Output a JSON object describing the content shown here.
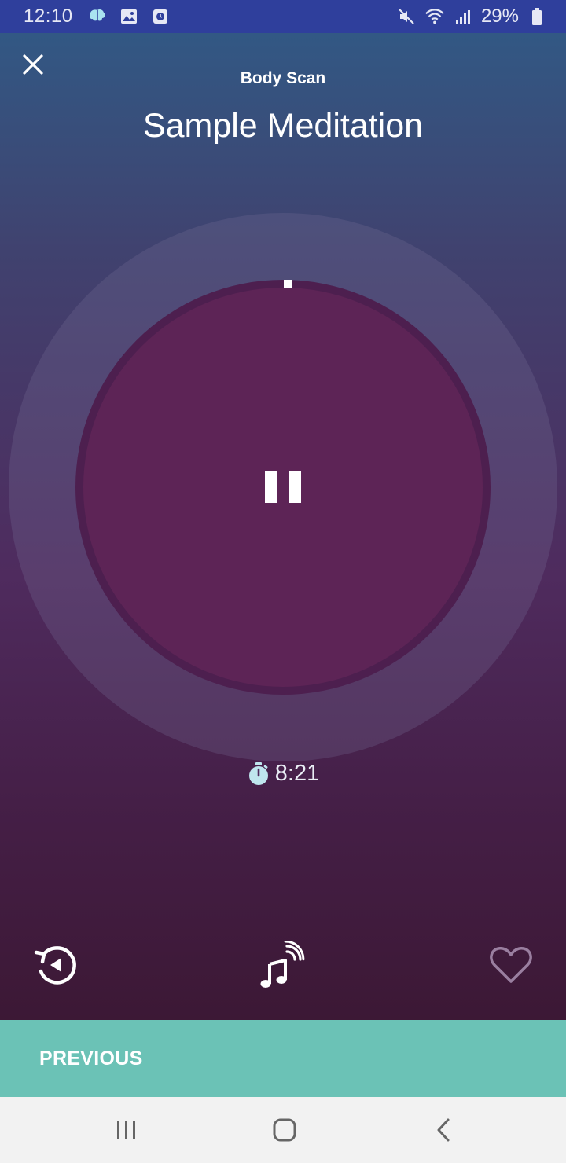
{
  "status_bar": {
    "time": "12:10",
    "battery_percent": "29%",
    "icons": [
      "brain-notification-icon",
      "gallery-notification-icon",
      "clock-notification-icon",
      "mute-icon",
      "wifi-icon",
      "signal-icon",
      "battery-icon"
    ]
  },
  "player": {
    "category": "Body Scan",
    "title": "Sample Meditation",
    "progress": 0.003,
    "state": "playing",
    "timer": "8:21"
  },
  "controls": {
    "items": [
      "replay-icon",
      "background-sound-icon",
      "favorite-heart-icon"
    ]
  },
  "footer": {
    "previous_label": "PREVIOUS"
  },
  "nav": {
    "items": [
      "recent-apps-icon",
      "home-icon",
      "back-icon"
    ]
  },
  "colors": {
    "status_bar": "#2f3f9c",
    "accent_teal": "#6bc2b6",
    "timer_icon": "#bfe6ee",
    "center_circle": "#5d2456"
  }
}
